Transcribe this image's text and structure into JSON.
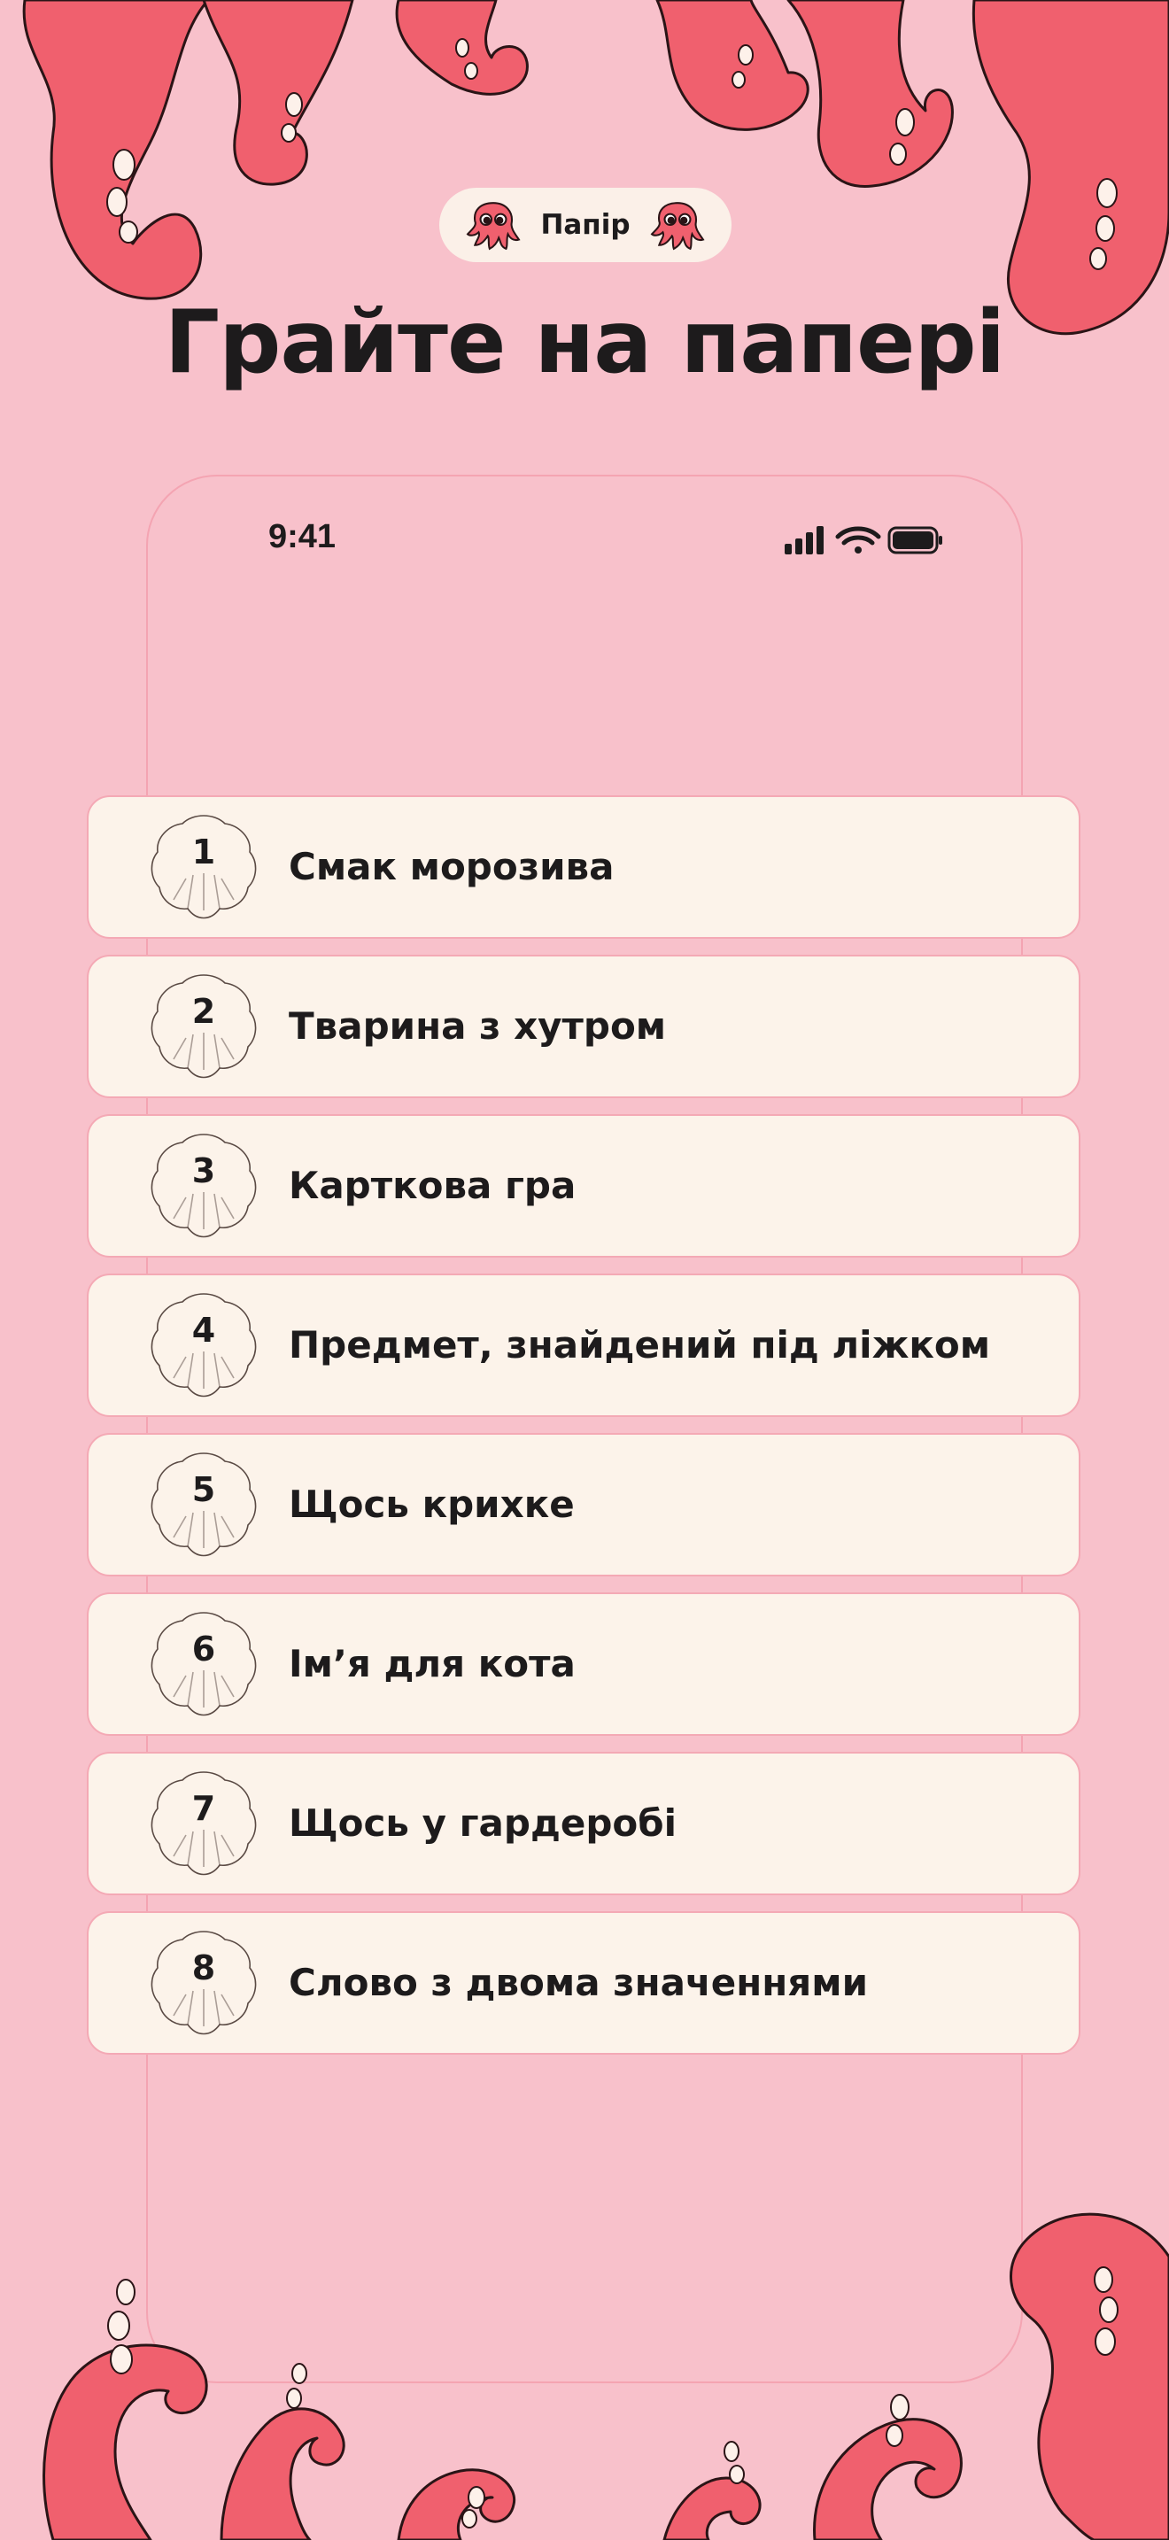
{
  "badge": {
    "label": "Папір",
    "icon": "octopus-icon"
  },
  "title": "Грайте на папері",
  "status_bar": {
    "time": "9:41",
    "icons": [
      "cellular-signal-icon",
      "wifi-icon",
      "battery-icon"
    ]
  },
  "items": [
    {
      "number": "1",
      "label": "Смак морозива"
    },
    {
      "number": "2",
      "label": "Тварина з хутром"
    },
    {
      "number": "3",
      "label": "Карткова гра"
    },
    {
      "number": "4",
      "label": "Предмет, знайдений під ліжком"
    },
    {
      "number": "5",
      "label": "Щось крихке"
    },
    {
      "number": "6",
      "label": "Ім’я для кота"
    },
    {
      "number": "7",
      "label": "Щось у гардеробі"
    },
    {
      "number": "8",
      "label": "Слово з двома значеннями"
    }
  ],
  "colors": {
    "background": "#f8c1cb",
    "tentacle": "#f0606e",
    "card": "#fcf3ea",
    "card_border": "#f4a9b5",
    "text": "#1d1b1c"
  }
}
